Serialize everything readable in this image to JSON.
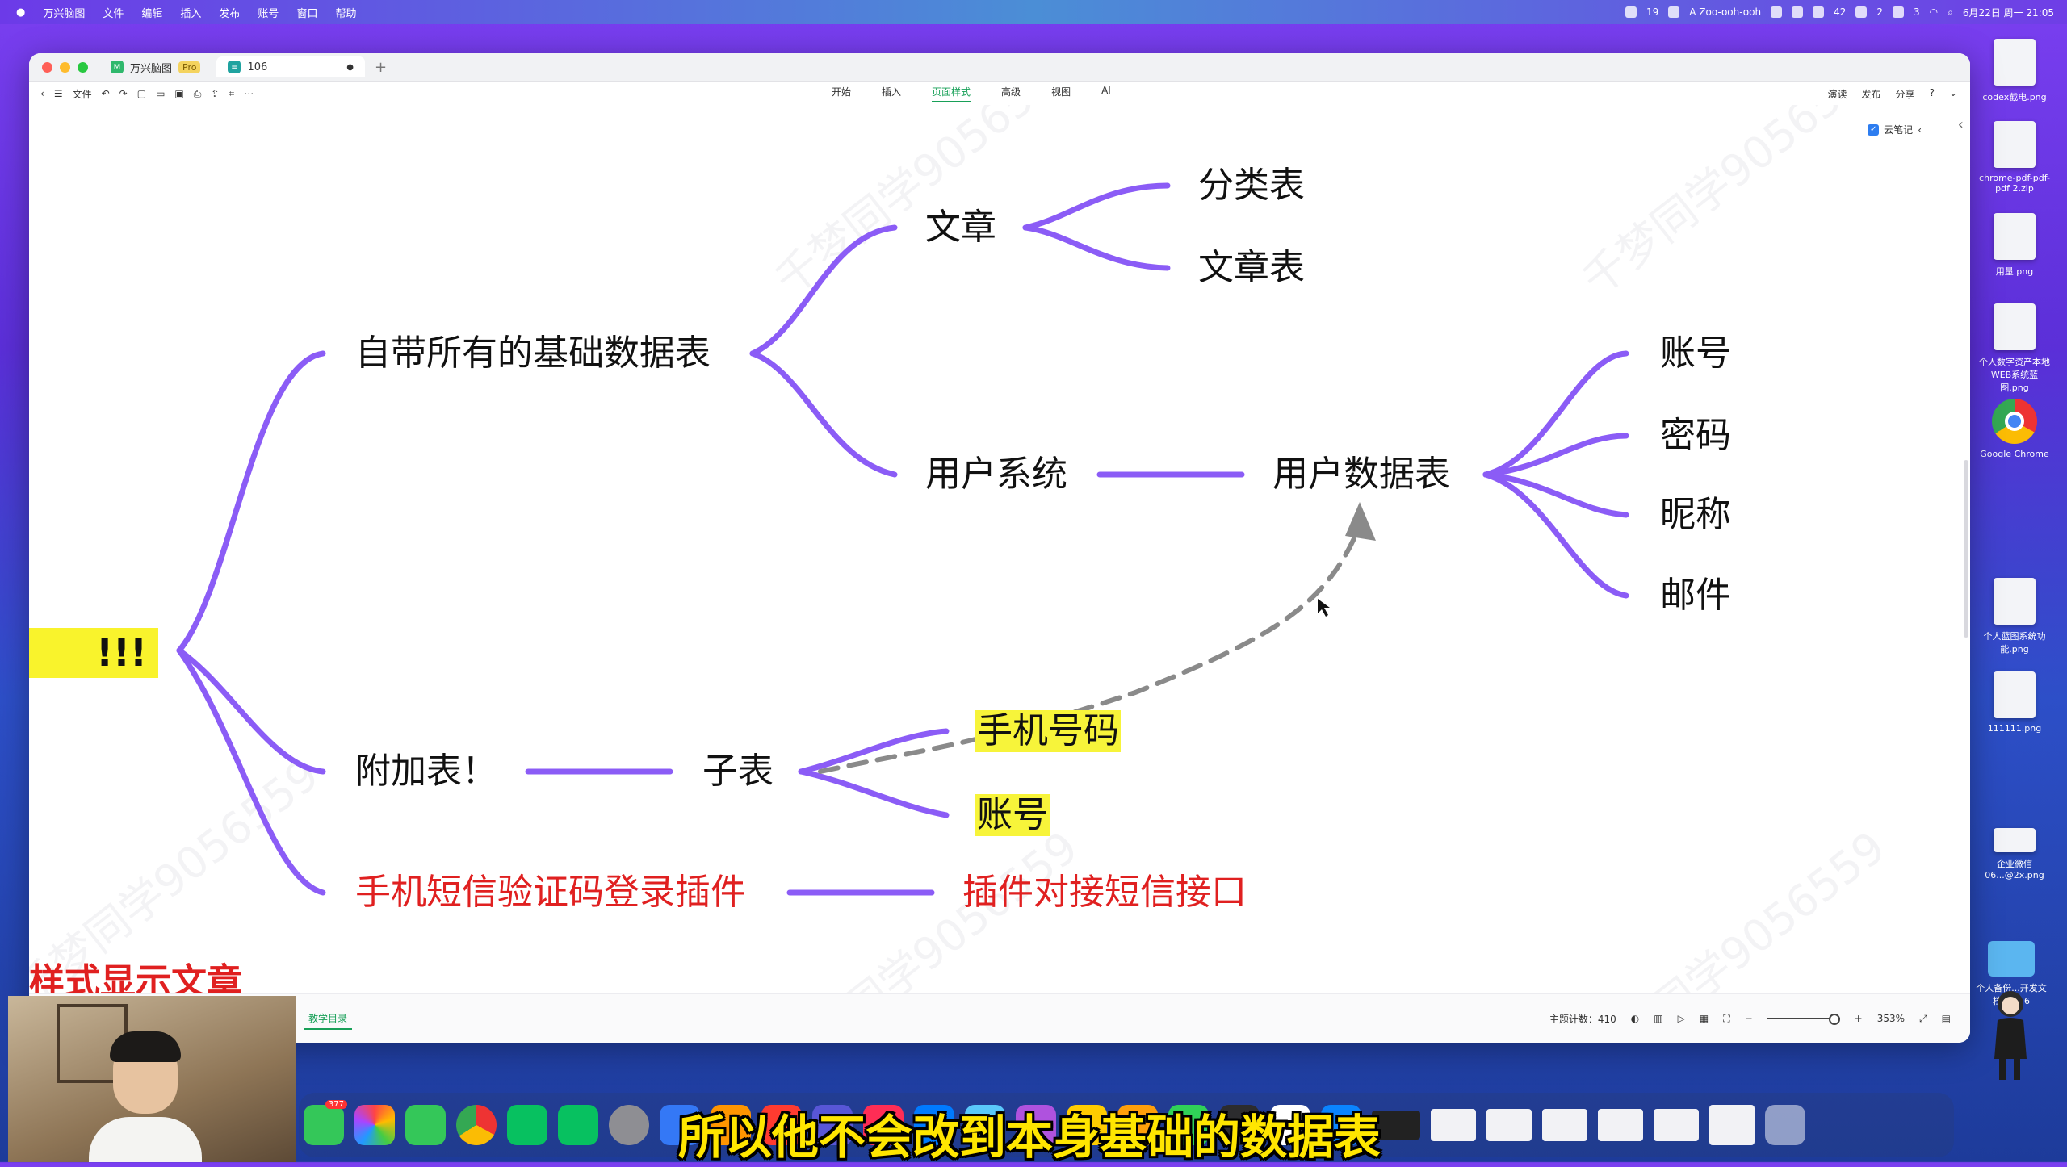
{
  "menubar": {
    "app_name": "万兴脑图",
    "menus": [
      "文件",
      "编辑",
      "插入",
      "发布",
      "账号",
      "窗口",
      "帮助"
    ],
    "tray": [
      "19",
      "A Zoo-ooh-ooh",
      "42",
      "2",
      "3"
    ],
    "clock": "6月22日 周一 21:05"
  },
  "window": {
    "tabs": [
      {
        "label": "万兴脑图",
        "badge": "Pro"
      },
      {
        "label": "106"
      }
    ],
    "toolbar": {
      "file_label": "文件",
      "menu": [
        "开始",
        "插入",
        "页面样式",
        "高级",
        "视图",
        "AI"
      ],
      "active_menu": "页面样式",
      "right": [
        "演读",
        "发布",
        "分享"
      ]
    },
    "cloud_notes": "云笔记"
  },
  "mindmap": {
    "root_text": "!!!",
    "left_cut_text": "样式显示文章",
    "nodes": {
      "builtin_tables": "自带所有的基础数据表",
      "article": "文章",
      "category_table": "分类表",
      "article_table": "文章表",
      "user_system": "用户系统",
      "user_data_table": "用户数据表",
      "account": "账号",
      "password": "密码",
      "nickname": "昵称",
      "email": "邮件",
      "extra_table": "附加表！",
      "sub_table": "子表",
      "phone_number": "手机号码",
      "sub_account": "账号",
      "sms_plugin": "手机短信验证码登录插件",
      "plugin_sms_api": "插件对接短信接口"
    },
    "watermark": "千梦同学9056559",
    "colors": {
      "branch": "#8b5cf6",
      "highlight": "#f7f43a",
      "red_text": "#e02020",
      "dashed_arrow": "#8a8a8a"
    }
  },
  "statusbar": {
    "outline_tab": "教学目录",
    "topic_count": "主题计数：410",
    "zoom": "353%"
  },
  "desktop": {
    "icons": [
      "codex截电.png",
      "chrome-pdf-pdf-pdf 2.zip",
      "用量.png",
      "个人数字资产本地WEB系统蓝图.png",
      "Google Chrome",
      "个人蓝图系统功能.png",
      "111111.png",
      "企业微信06...@2x.png",
      "个人备份...开发文档60616"
    ]
  },
  "dock": {
    "messages_badge": "377"
  },
  "subtitle": "所以他不会改到本身基础的数据表"
}
